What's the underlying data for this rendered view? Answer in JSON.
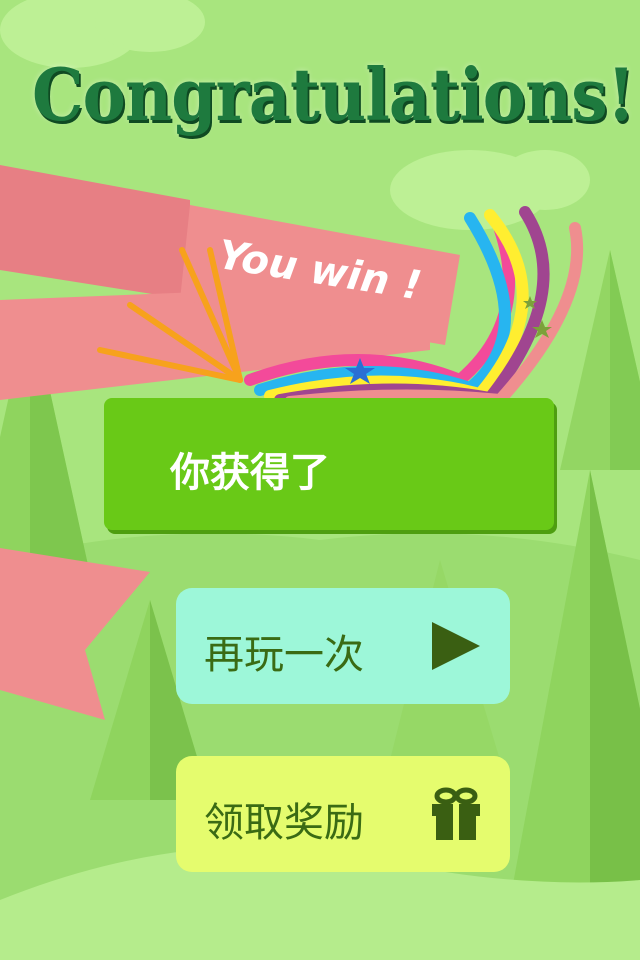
{
  "title": "Congratulations!",
  "ribbon": {
    "text": "You win !"
  },
  "reward_box": {
    "label": "你获得了"
  },
  "buttons": {
    "replay": {
      "label": "再玩一次",
      "icon": "play-icon"
    },
    "claim": {
      "label": "领取奖励",
      "icon": "gift-icon"
    }
  },
  "colors": {
    "background": "#a8e57e",
    "title": "#1e7a3e",
    "ribbon": "#ef8e8f",
    "reward_box": "#69c917",
    "replay_button": "#9df7d9",
    "claim_button": "#e5fc6e",
    "icon": "#3a5f12"
  }
}
